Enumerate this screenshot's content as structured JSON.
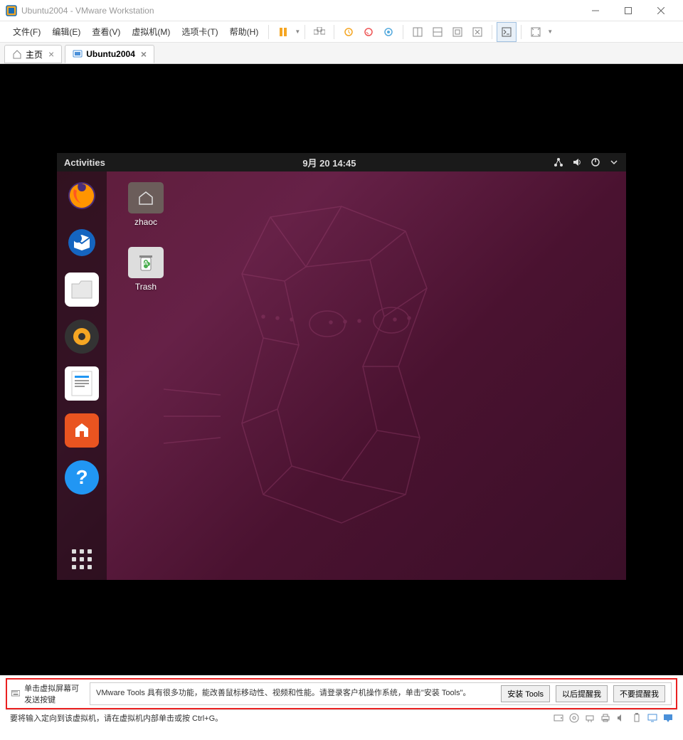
{
  "titlebar": {
    "title": "Ubuntu2004 - VMware Workstation"
  },
  "menu": {
    "file": "文件(F)",
    "edit": "编辑(E)",
    "view": "查看(V)",
    "vm": "虚拟机(M)",
    "tabs": "选项卡(T)",
    "help": "帮助(H)"
  },
  "tabs": {
    "home": "主页",
    "vm": "Ubuntu2004"
  },
  "ubuntu": {
    "activities": "Activities",
    "clock": "9月 20  14:45",
    "desktop": {
      "home_label": "zhaoc",
      "trash_label": "Trash"
    }
  },
  "notice": {
    "keyboard_hint": "单击虚拟屏幕可发送按键",
    "tip": "VMware Tools 具有很多功能，能改善鼠标移动性、视频和性能。请登录客户机操作系统，单击\"安装 Tools\"。",
    "btn_install": "安装 Tools",
    "btn_later": "以后提醒我",
    "btn_never": "不要提醒我"
  },
  "statusbar": {
    "text": "要将输入定向到该虚拟机，请在虚拟机内部单击或按 Ctrl+G。"
  }
}
